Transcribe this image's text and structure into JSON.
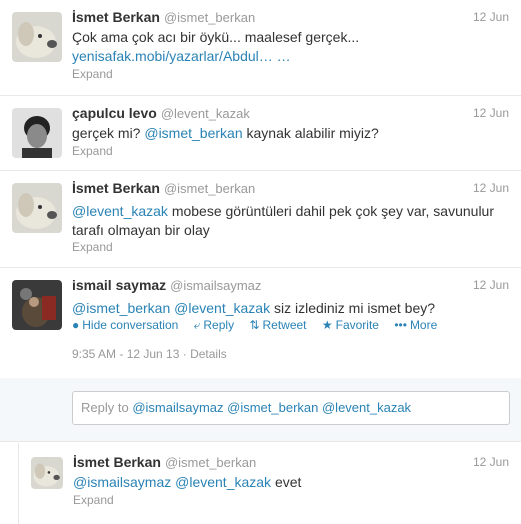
{
  "tweets": [
    {
      "fullname": "İsmet Berkan",
      "username": "@ismet_berkan",
      "time": "12 Jun",
      "text": "Çok ama çok acı bir öykü... maalesef gerçek...",
      "link": "yenisafak.mobi/yazarlar/Abdul…",
      "link_suffix": " …",
      "expand": "Expand"
    },
    {
      "fullname": "çapulcu levo",
      "username": "@levent_kazak",
      "time": "12 Jun",
      "text_before": "gerçek mi? ",
      "mention": "@ismet_berkan",
      "text_after": " kaynak alabilir miyiz?",
      "expand": "Expand"
    },
    {
      "fullname": "İsmet Berkan",
      "username": "@ismet_berkan",
      "time": "12 Jun",
      "mention": "@levent_kazak",
      "text_after": " mobese görüntüleri dahil pek çok şey var, savunulur tarafı olmayan bir olay",
      "expand": "Expand"
    },
    {
      "fullname": "ismail saymaz",
      "username": "@ismailsaymaz",
      "time": "12 Jun",
      "mention1": "@ismet_berkan",
      "mention2": "@levent_kazak",
      "text_after": " siz izlediniz mi ismet bey?",
      "actions": {
        "hide": "Hide conversation",
        "reply": "Reply",
        "retweet": "Retweet",
        "favorite": "Favorite",
        "more": "More"
      },
      "meta": "9:35 AM - 12 Jun 13 · Details"
    }
  ],
  "reply_box": {
    "prefix": "Reply to ",
    "mentions": "@ismailsaymaz @ismet_berkan @levent_kazak"
  },
  "subtweet": {
    "fullname": "İsmet Berkan",
    "username": "@ismet_berkan",
    "time": "12 Jun",
    "mention1": "@ismailsaymaz",
    "mention2": "@levent_kazak",
    "text_after": " evet",
    "expand": "Expand"
  },
  "colors": {
    "link": "#2a83b5",
    "muted": "#999999",
    "text": "#333333"
  }
}
